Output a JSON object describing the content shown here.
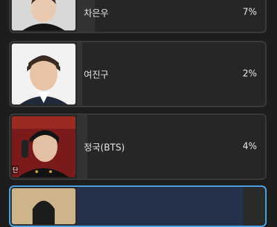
{
  "items": [
    {
      "name": "차은우",
      "percent": "7%",
      "share": 0.07
    },
    {
      "name": "여진구",
      "percent": "2%",
      "share": 0.02
    },
    {
      "name": "정국(BTS)",
      "percent": "4%",
      "share": 0.04,
      "photo_tag": "단"
    },
    {
      "name": "",
      "percent": "",
      "share": 0.85,
      "selected": true
    }
  ],
  "colors": {
    "background": "#1d1d1d",
    "card": "#262626",
    "card_border": "#3a3a3a",
    "selected_border": "#4aa8e8",
    "text": "#e6e6e6"
  }
}
